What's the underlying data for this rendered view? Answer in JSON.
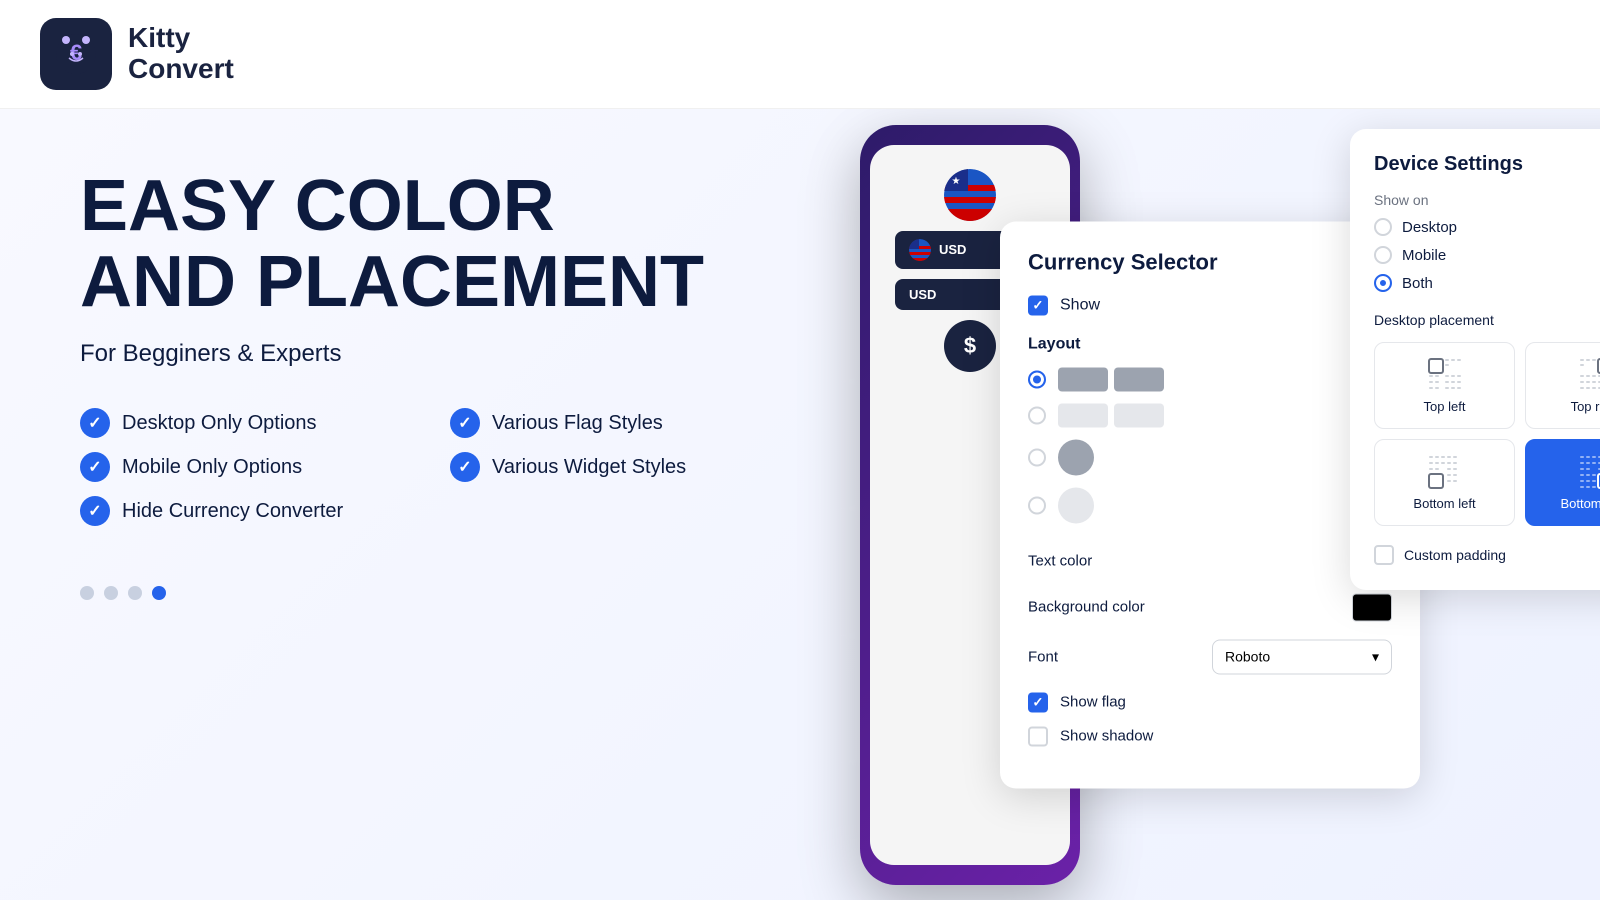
{
  "header": {
    "logo_alt": "Kitty Convert Logo",
    "app_name_line1": "Kitty",
    "app_name_line2": "Convert"
  },
  "hero": {
    "title_line1": "EASY COLOR",
    "title_line2": "AND PLACEMENT",
    "subtitle": "For Begginers & Experts",
    "features": [
      "Desktop Only Options",
      "Various Flag Styles",
      "Mobile Only Options",
      "Various Widget Styles",
      "Hide Currency Converter"
    ]
  },
  "currency_selector": {
    "title": "Currency Selector",
    "show_label": "Show",
    "layout_label": "Layout",
    "text_color_label": "Text color",
    "bg_color_label": "Background color",
    "font_label": "Font",
    "font_value": "Roboto",
    "show_flag_label": "Show flag",
    "show_shadow_label": "Show shadow"
  },
  "device_settings": {
    "title": "Device Settings",
    "show_on_label": "Show on",
    "options": [
      "Desktop",
      "Mobile",
      "Both"
    ],
    "selected_show_on": "Both",
    "desktop_placement_label": "Desktop placement",
    "placements": [
      "Top left",
      "Top right",
      "Bottom left",
      "Bottom right"
    ],
    "selected_placement": "Bottom right",
    "custom_padding_label": "Custom padding"
  },
  "dots": [
    1,
    2,
    3,
    4
  ],
  "active_dot": 4,
  "widgets": {
    "currency_code": "USD",
    "dollar_symbol": "$"
  }
}
